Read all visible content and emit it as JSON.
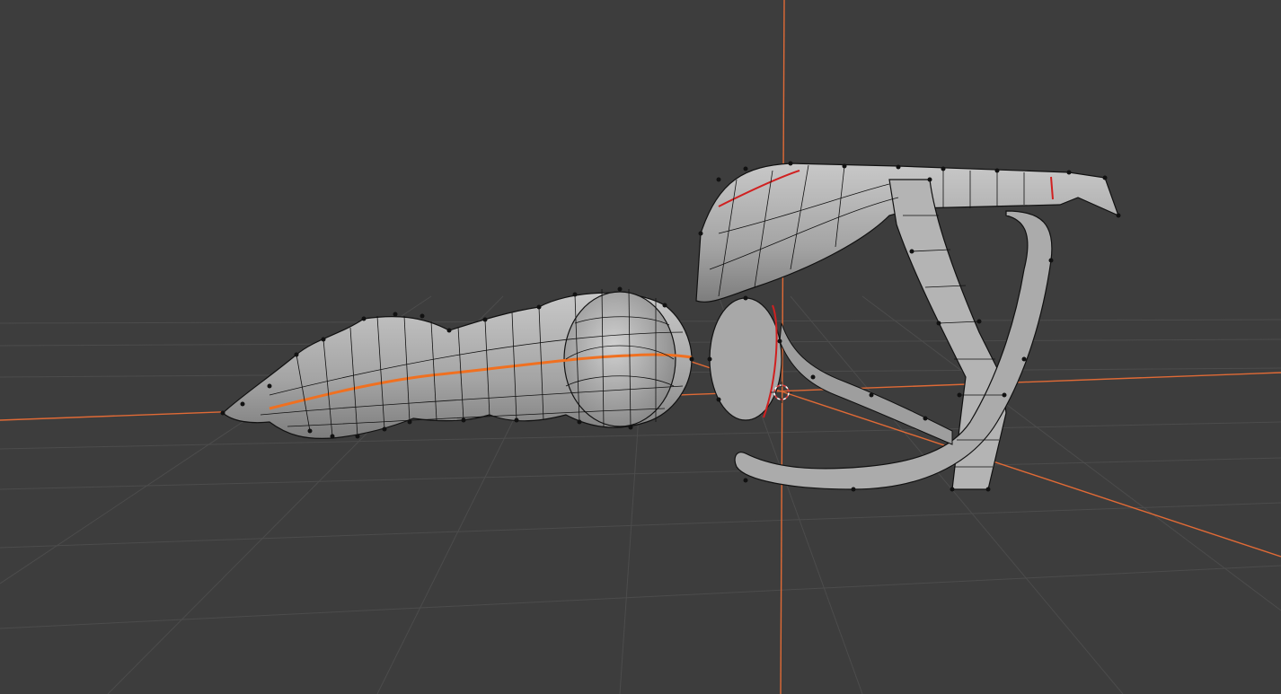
{
  "viewport": {
    "background": "#3d3d3d",
    "grid_color": "#4a4a4a",
    "axis_x_color": "#e8703a",
    "axis_z_color": "#e8703a"
  },
  "mesh": {
    "fill": "#a9a9a9",
    "wire": "#111111",
    "seam_color": "#f07020",
    "selected_edge_color": "#d02020"
  },
  "scene": {
    "object": "mesh-in-edit-mode",
    "has_3d_cursor": true
  }
}
